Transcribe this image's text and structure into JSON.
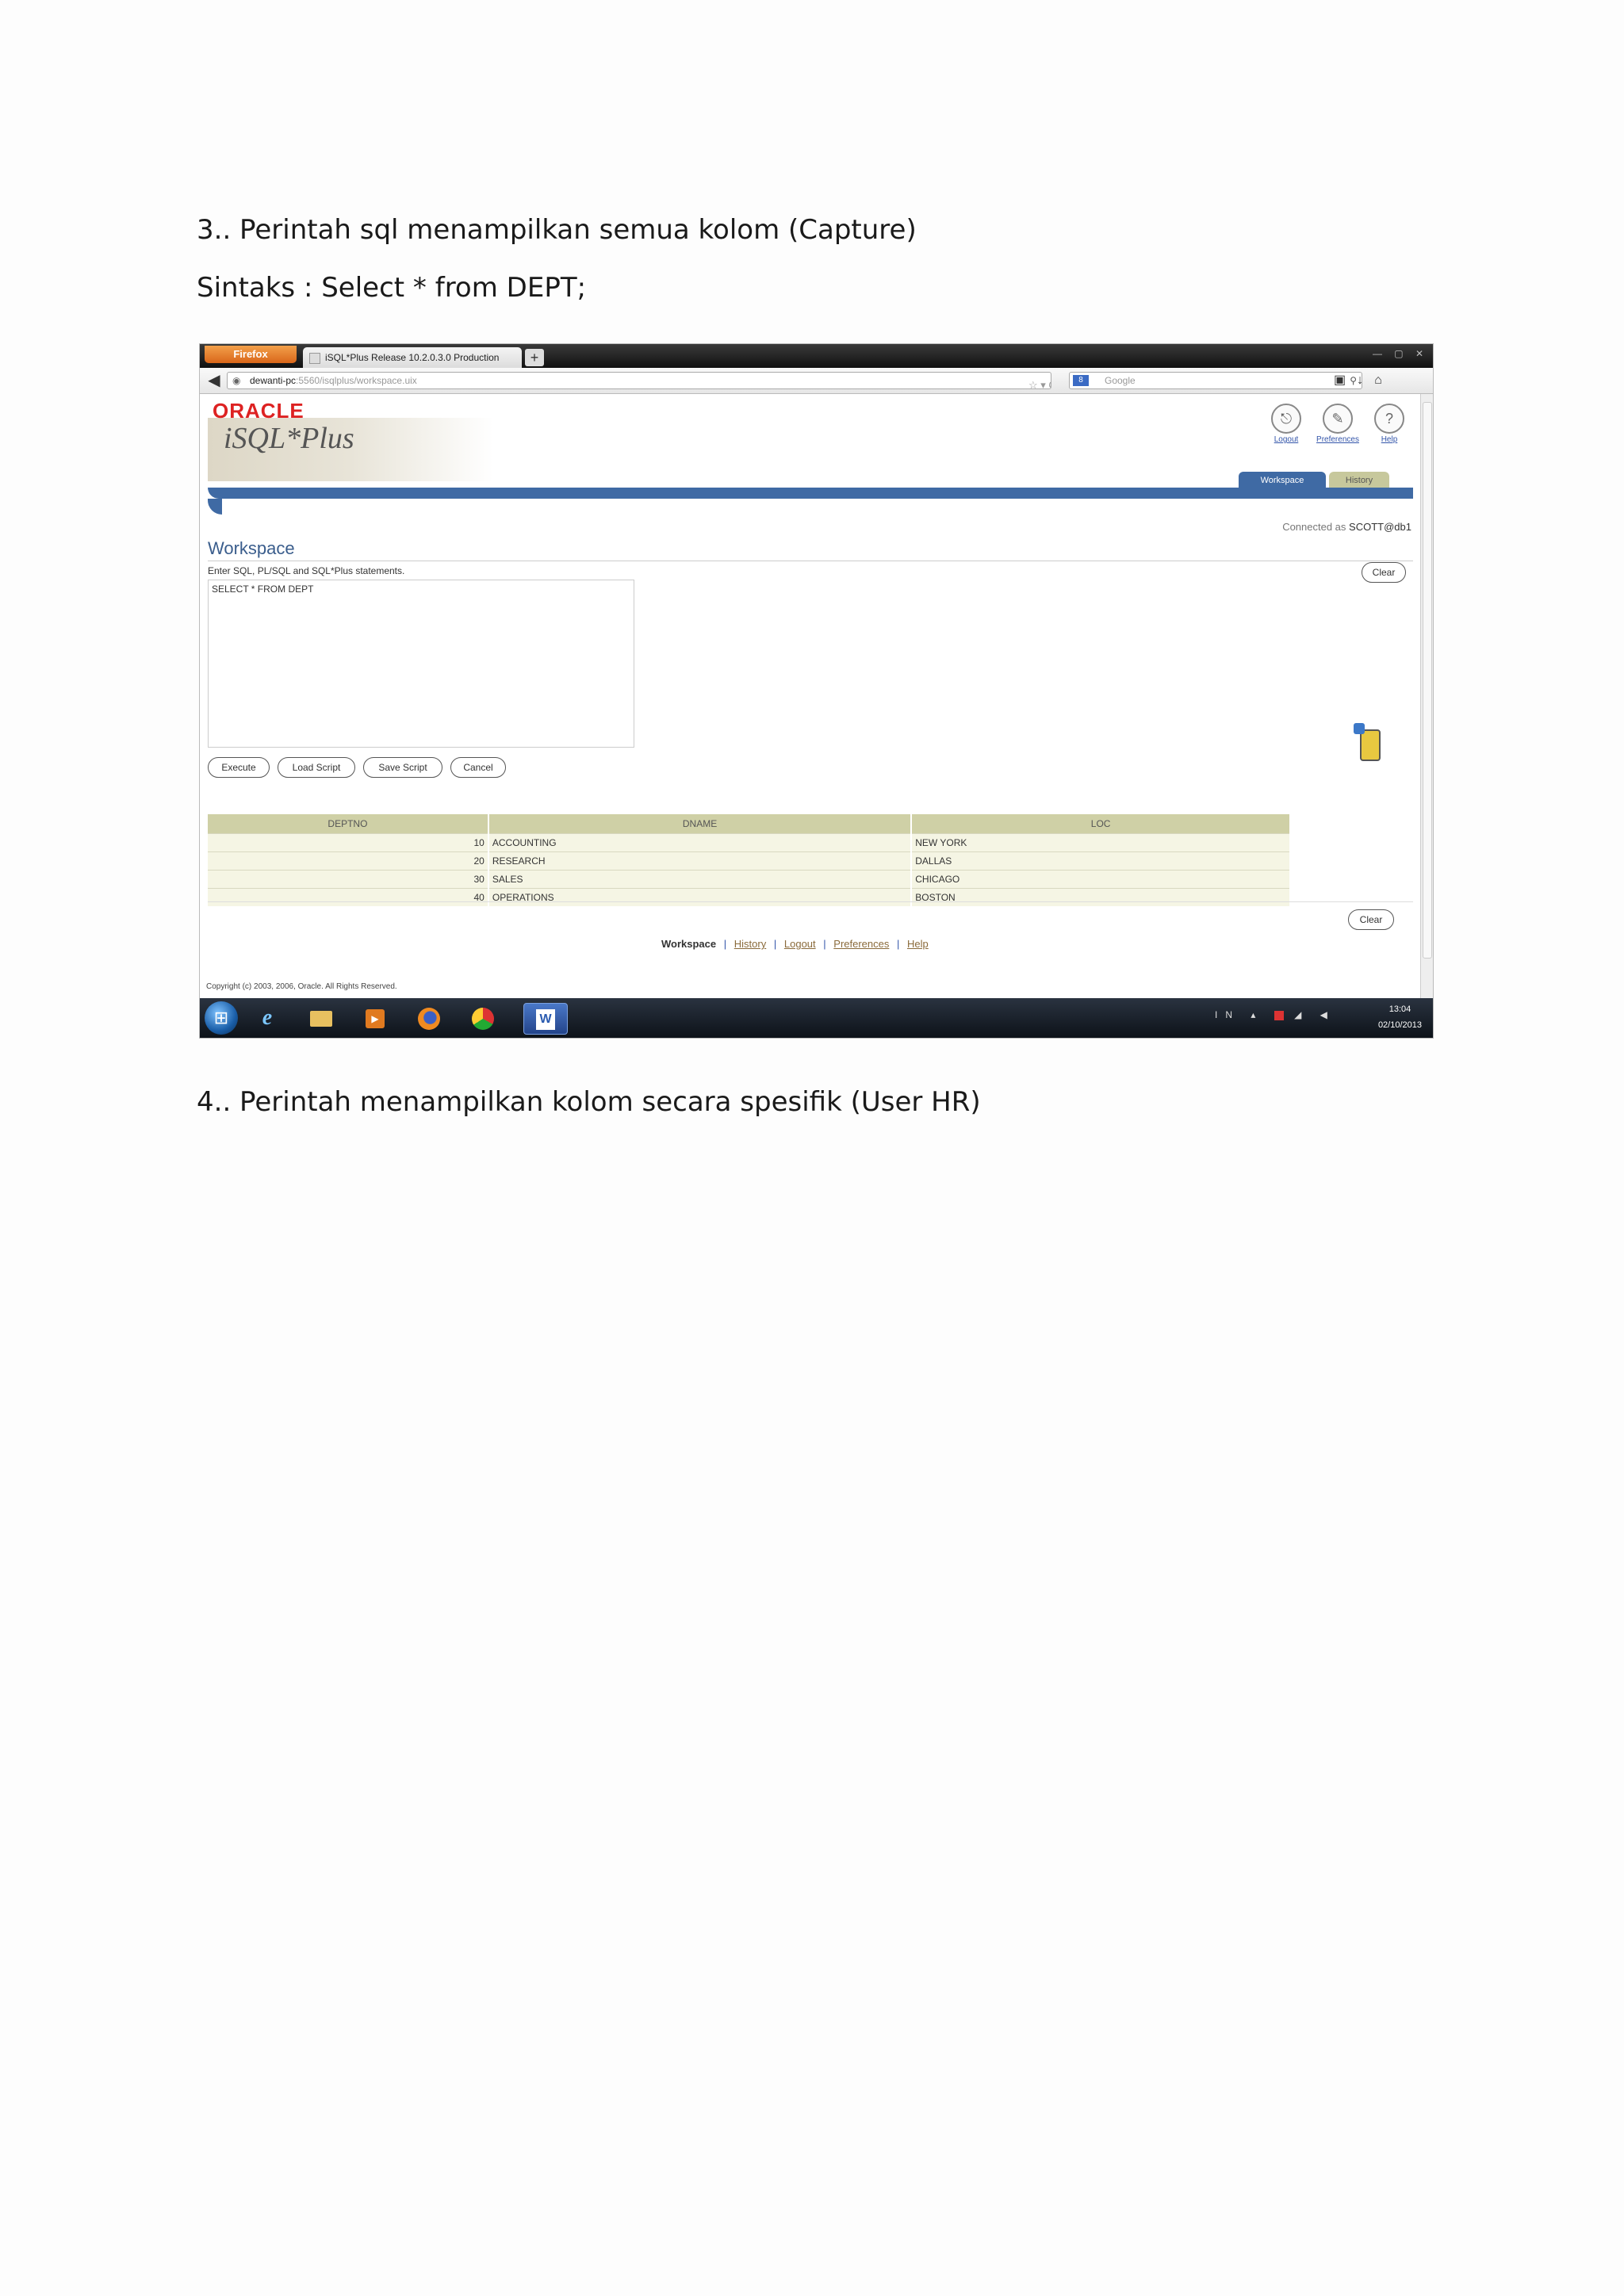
{
  "document": {
    "heading3": "3.. Perintah sql menampilkan semua kolom (Capture)",
    "syntax": "Sintaks : Select * from DEPT;",
    "heading4": "4.. Perintah menampilkan kolom secara spesifik (User HR)"
  },
  "browser": {
    "menu_button": "Firefox",
    "tab_title": "iSQL*Plus Release 10.2.0.3.0 Production",
    "new_tab": "+",
    "url_host": "dewanti-pc",
    "url_tail": ":5560/isqlplus/workspace.uix",
    "search_placeholder": "Google",
    "search_engine_letter": "8"
  },
  "app": {
    "brand": "ORACLE",
    "product": "iSQL*Plus",
    "global_links": {
      "logout": "Logout",
      "preferences": "Preferences",
      "help": "Help"
    },
    "tabs": {
      "workspace": "Workspace",
      "history": "History"
    },
    "connected_as_label": "Connected as",
    "connected_as_user": "SCOTT@db1",
    "workspace_title": "Workspace",
    "instructions": "Enter SQL, PL/SQL and SQL*Plus statements.",
    "sql_text": "SELECT * FROM DEPT",
    "buttons": {
      "clear": "Clear",
      "execute": "Execute",
      "load_script": "Load Script",
      "save_script": "Save Script",
      "cancel": "Cancel"
    },
    "results": {
      "columns": [
        "DEPTNO",
        "DNAME",
        "LOC"
      ],
      "rows": [
        [
          "10",
          "ACCOUNTING",
          "NEW YORK"
        ],
        [
          "20",
          "RESEARCH",
          "DALLAS"
        ],
        [
          "30",
          "SALES",
          "CHICAGO"
        ],
        [
          "40",
          "OPERATIONS",
          "BOSTON"
        ]
      ]
    },
    "footer": {
      "current": "Workspace",
      "links": [
        "History",
        "Logout",
        "Preferences",
        "Help"
      ],
      "separator": "|"
    },
    "copyright": "Copyright (c) 2003, 2006, Oracle. All Rights Reserved."
  },
  "taskbar": {
    "clock_time": "13:04",
    "clock_date": "02/10/2013",
    "tray_lang": "IN"
  }
}
